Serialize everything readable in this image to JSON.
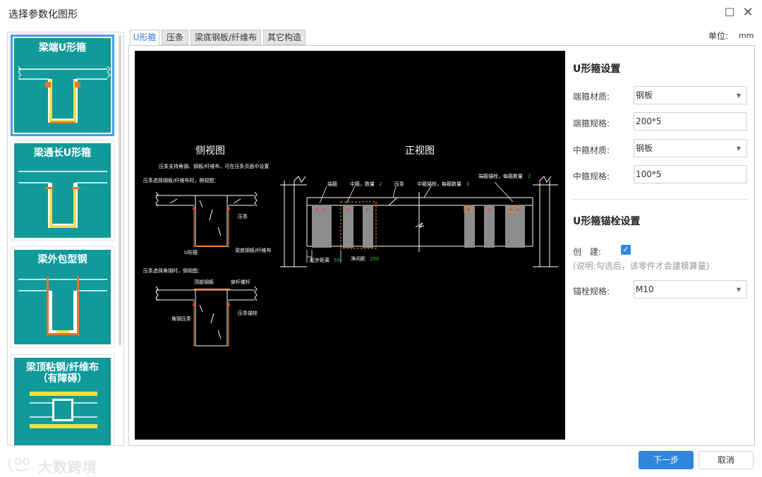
{
  "window": {
    "title": "选择参数化图形",
    "maximize_icon": "maximize-icon",
    "close_icon": "close-icon"
  },
  "sidebar": {
    "items": [
      {
        "label": "梁端U形箍",
        "selected": true
      },
      {
        "label": "梁通长U形箍",
        "selected": false
      },
      {
        "label": "梁外包型钢",
        "selected": false
      },
      {
        "label": "梁顶粘钢/纤维布\n（有障碍）",
        "selected": false
      }
    ]
  },
  "tabs": [
    {
      "label": "U形箍",
      "active": true
    },
    {
      "label": "压条",
      "active": false
    },
    {
      "label": "梁底钢板/纤维布",
      "active": false
    },
    {
      "label": "其它构造",
      "active": false
    }
  ],
  "unit": {
    "label": "单位:",
    "value": "mm"
  },
  "drawing": {
    "side_view_title": "侧视图",
    "front_view_title": "正视图",
    "side_note": "压条支持角钢、钢板/纤维布，可在压条页面中设置",
    "case1_note": "压条选择钢板/纤维布时，侧视图：",
    "case2_note": "压条选择角钢时，侧视图：",
    "label_strip": "压条",
    "label_ustirrup": "U形箍",
    "label_bottom_plate": "梁底钢板/纤维布",
    "label_top_plate": "顶部钢板",
    "label_through_bolt": "穿杆螺杆",
    "label_angle_strip": "角钢压条",
    "label_strip_anchor": "压条锚栓",
    "label_end_stirrup": "端箍",
    "label_mid_stirrup": "中箍，数量",
    "label_mid_count": "2",
    "label_front_strip": "压条",
    "label_mid_anchor": "中箍锚栓，每箍数量",
    "label_mid_anchor_count": "3",
    "label_end_anchor": "端箍锚栓，每箍数量",
    "label_end_anchor_count": "2",
    "label_start_dist": "起步距离",
    "label_start_dist_val": "50",
    "label_spacing": "净间距",
    "label_spacing_val": "200",
    "colors": {
      "bg": "#000000",
      "line": "#ffffff",
      "plate": "#8c8c8c",
      "anchor": "#e03a3a",
      "dim": "#32c832",
      "accent": "#f08c28"
    }
  },
  "stirrup_settings": {
    "title": "U形箍设置",
    "end_material_label": "端箍材质:",
    "end_material": "钢板",
    "end_spec_label": "端箍规格:",
    "end_spec": "200*5",
    "mid_material_label": "中箍材质:",
    "mid_material": "钢板",
    "mid_spec_label": "中箍规格:",
    "mid_spec": "100*5"
  },
  "anchor_settings": {
    "title": "U形箍锚栓设置",
    "create_label": "创　建:",
    "create_checked": true,
    "hint": "(说明:勾选后，该零件才会建模算量)",
    "spec_label": "锚栓规格:",
    "spec": "M10"
  },
  "buttons": {
    "next": "下一步",
    "cancel": "取消"
  },
  "watermark": {
    "text": "大数跨境"
  },
  "theme": {
    "accent": "#2f86de",
    "thumb_bg": "#109a9a",
    "thumb_yellow": "#f0e04a",
    "thumb_orange": "#e8742a"
  }
}
